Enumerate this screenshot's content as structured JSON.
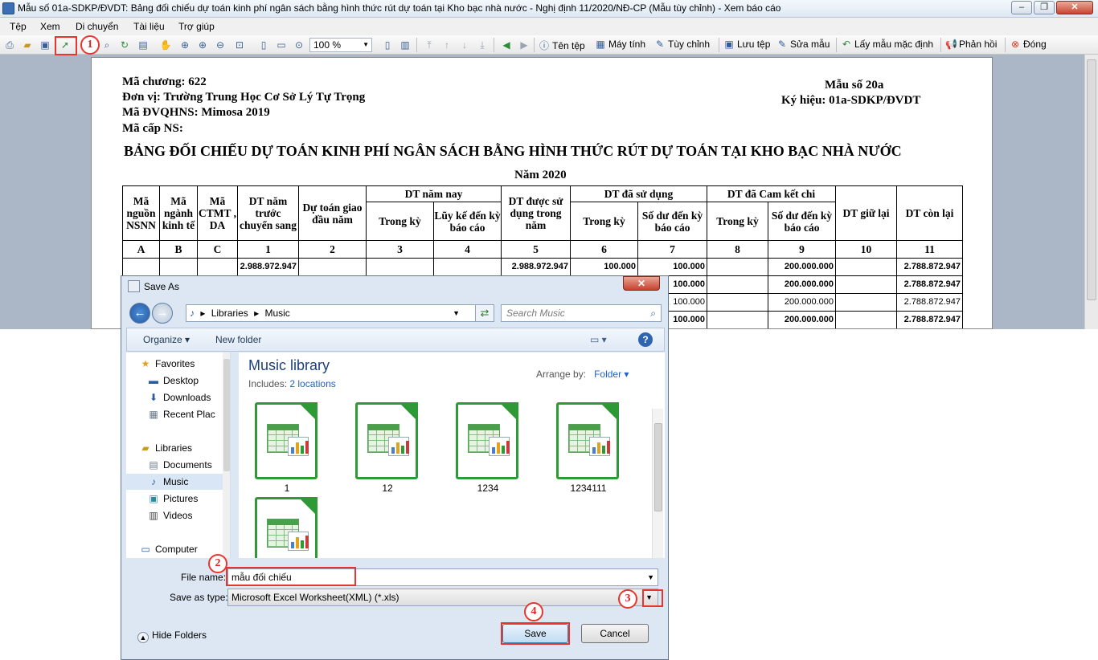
{
  "window": {
    "title": "Mẫu số 01a-SDKP/ĐVDT: Bảng đối chiếu dự toán kinh phí ngân sách bằng hình thức rút dự toán tại Kho bạc nhà nước - Nghị định 11/2020/NĐ-CP (Mẫu tùy chỉnh) - Xem báo cáo",
    "buttons": {
      "minimize": "–",
      "maximize": "❐",
      "close": "✕"
    }
  },
  "menu": [
    "Tệp",
    "Xem",
    "Di chuyển",
    "Tài liệu",
    "Trợ giúp"
  ],
  "toolbar": {
    "zoom": "100 %",
    "actions": {
      "ten_tep": "Tên tệp",
      "may_tinh": "Máy tính",
      "tuy_chinh": "Tùy chỉnh",
      "luu_tep": "Lưu tệp",
      "sua_mau": "Sửa mẫu",
      "lay_mau": "Lấy mẫu mặc định",
      "phan_hoi": "Phản hồi",
      "dong": "Đóng"
    }
  },
  "annotations": {
    "step1": "1",
    "step2": "2",
    "step3": "3",
    "step4": "4"
  },
  "report": {
    "ma_chuong": "Mã chương: 622",
    "don_vi": "Đơn vị: Trường Trung Học Cơ Sở Lý Tự Trọng",
    "ma_dvqhns": "Mã ĐVQHNS: Mimosa 2019",
    "ma_cap_ns": "Mã cấp NS:",
    "mau_so": "Mẫu số 20a",
    "ky_hieu": "Ký hiệu: 01a-SDKP/ĐVDT",
    "title": "BẢNG ĐỐI CHIẾU DỰ TOÁN KINH PHÍ NGÂN SÁCH BẰNG HÌNH THỨC RÚT DỰ TOÁN TẠI KHO BẠC NHÀ NƯỚC",
    "year": "Năm 2020",
    "headers": {
      "ma_nguon": "Mã nguồn NSNN",
      "ma_nganh": "Mã ngành kinh tế",
      "ctmt": "Mã CTMT , DA",
      "dt_truoc": "DT năm trước chuyển sang",
      "du_toan_giao": "Dự toán giao đầu năm",
      "dt_nam_nay": "DT năm nay",
      "trong_ky": "Trong kỳ",
      "luy_ke": "Lũy kế đến kỳ báo cáo",
      "dt_duoc_su_dung": "DT được sử dụng trong năm",
      "dt_da_su_dung": "DT đã sử dụng",
      "so_du": "Số dư đến kỳ báo cáo",
      "dt_cam_ket": "DT đã Cam kết chi",
      "dt_giu_lai": "DT giữ lại",
      "dt_con_lai": "DT còn lại"
    },
    "col_codes": [
      "A",
      "B",
      "C",
      "1",
      "2",
      "3",
      "4",
      "5",
      "6",
      "7",
      "8",
      "9",
      "10",
      "11"
    ],
    "rows": [
      [
        "",
        "",
        "",
        "2.988.972.947",
        "",
        "",
        "",
        "2.988.972.947",
        "100.000",
        "100.000",
        "",
        "200.000.000",
        "",
        "2.788.872.947"
      ],
      [
        "",
        "",
        "",
        "",
        "",
        "",
        "",
        "",
        "",
        "100.000",
        "",
        "200.000.000",
        "",
        "2.788.872.947"
      ],
      [
        "",
        "",
        "",
        "",
        "",
        "",
        "",
        "",
        "",
        "100.000",
        "",
        "200.000.000",
        "",
        "2.788.872.947"
      ],
      [
        "",
        "",
        "",
        "",
        "",
        "",
        "",
        "",
        "",
        "100.000",
        "",
        "200.000.000",
        "",
        "2.788.872.947"
      ]
    ]
  },
  "dialog": {
    "title": "Save As",
    "close": "✕",
    "breadcrumb": {
      "part1": "Libraries",
      "part2": "Music"
    },
    "search_placeholder": "Search Music",
    "organize": "Organize ▾",
    "new_folder": "New folder",
    "help": "?",
    "nav": {
      "favorites": "Favorites",
      "desktop": "Desktop",
      "downloads": "Downloads",
      "recent": "Recent Plac",
      "libraries": "Libraries",
      "documents": "Documents",
      "music": "Music",
      "pictures": "Pictures",
      "videos": "Videos",
      "computer": "Computer"
    },
    "library_title": "Music library",
    "includes_label": "Includes:",
    "includes_link": "2 locations",
    "arrange_label": "Arrange by:",
    "arrange_value": "Folder",
    "files": [
      "1",
      "12",
      "1234",
      "1234111",
      ""
    ],
    "file_name_label": "File name:",
    "file_name_value": "mẫu đối chiếu",
    "save_type_label": "Save as type:",
    "save_type_value": "Microsoft Excel Worksheet(XML) (*.xls)",
    "save": "Save",
    "cancel": "Cancel",
    "hide_folders": "Hide Folders"
  }
}
